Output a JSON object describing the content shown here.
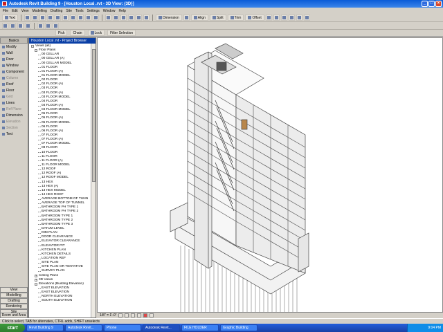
{
  "window": {
    "title": "Autodesk Revit Building 9 - [Houston Local .rvt - 3D View: {3D}]"
  },
  "menu": [
    "File",
    "Edit",
    "View",
    "Modelling",
    "Drafting",
    "Site",
    "Tools",
    "Settings",
    "Window",
    "Help"
  ],
  "toolbar1": {
    "text_tool": "Text",
    "dimension": "Dimension",
    "align": "Align",
    "split": "Split",
    "trim": "Trim",
    "offset": "Offset"
  },
  "toolbar3": {
    "pick": "Pick",
    "chain": "Chain",
    "lock": "Lock",
    "filter": "Filter Selection"
  },
  "design_bar": {
    "header": "Basics",
    "items": [
      {
        "label": "Modify",
        "dim": false
      },
      {
        "label": "Wall",
        "dim": false
      },
      {
        "label": "Door",
        "dim": false
      },
      {
        "label": "Window",
        "dim": false
      },
      {
        "label": "Component",
        "dim": false
      },
      {
        "label": "Column",
        "dim": true
      },
      {
        "label": "Roof",
        "dim": false
      },
      {
        "label": "Floor",
        "dim": false
      },
      {
        "label": "Grid",
        "dim": true
      },
      {
        "label": "Lines",
        "dim": false
      },
      {
        "label": "Ref Plane",
        "dim": true
      },
      {
        "label": "Dimension",
        "dim": false
      },
      {
        "label": "Elevation",
        "dim": true
      },
      {
        "label": "Section",
        "dim": true
      },
      {
        "label": "Text",
        "dim": false
      }
    ],
    "tabs": [
      "View",
      "Modelling",
      "Drafting",
      "Rendering",
      "Site",
      "Room and Area"
    ]
  },
  "browser": {
    "title": "Houston Local .rvt - Project Browser",
    "tree": [
      {
        "indent": 0,
        "box": "-",
        "label": "Views (all)"
      },
      {
        "indent": 1,
        "box": "-",
        "label": "Floor Plans"
      },
      {
        "indent": 2,
        "box": "",
        "label": "00 CELLAR"
      },
      {
        "indent": 2,
        "box": "",
        "label": "00 CELLAR (A)"
      },
      {
        "indent": 2,
        "box": "",
        "label": "00 CELLAR MODEL"
      },
      {
        "indent": 2,
        "box": "",
        "label": "01 FLOOR"
      },
      {
        "indent": 2,
        "box": "",
        "label": "01 FLOOR (A)"
      },
      {
        "indent": 2,
        "box": "",
        "label": "01 FLOOR MODEL"
      },
      {
        "indent": 2,
        "box": "",
        "label": "02 FLOOR"
      },
      {
        "indent": 2,
        "box": "",
        "label": "02 FLOOR (A)"
      },
      {
        "indent": 2,
        "box": "",
        "label": "03 FLOOR"
      },
      {
        "indent": 2,
        "box": "",
        "label": "03 FLOOR (A)"
      },
      {
        "indent": 2,
        "box": "",
        "label": "03 FLOOR MODEL"
      },
      {
        "indent": 2,
        "box": "",
        "label": "04 FLOOR"
      },
      {
        "indent": 2,
        "box": "",
        "label": "04 FLOOR (A)"
      },
      {
        "indent": 2,
        "box": "",
        "label": "04 FLOOR MODEL"
      },
      {
        "indent": 2,
        "box": "",
        "label": "05 FLOOR"
      },
      {
        "indent": 2,
        "box": "",
        "label": "05 FLOOR (A)"
      },
      {
        "indent": 2,
        "box": "",
        "label": "05 FLOOR MODEL"
      },
      {
        "indent": 2,
        "box": "",
        "label": "06 FLOOR"
      },
      {
        "indent": 2,
        "box": "",
        "label": "06 FLOOR (A)"
      },
      {
        "indent": 2,
        "box": "",
        "label": "07 FLOOR"
      },
      {
        "indent": 2,
        "box": "",
        "label": "07 FLOOR (A)"
      },
      {
        "indent": 2,
        "box": "",
        "label": "07 FLOOR MODEL"
      },
      {
        "indent": 2,
        "box": "",
        "label": "08 FLOOR"
      },
      {
        "indent": 2,
        "box": "",
        "label": "10 FLOOR"
      },
      {
        "indent": 2,
        "box": "",
        "label": "11 FLOOR"
      },
      {
        "indent": 2,
        "box": "",
        "label": "11 FLOOR (A)"
      },
      {
        "indent": 2,
        "box": "",
        "label": "11 FLOOR MODEL"
      },
      {
        "indent": 2,
        "box": "",
        "label": "12 ROOF"
      },
      {
        "indent": 2,
        "box": "",
        "label": "12 ROOF (A)"
      },
      {
        "indent": 2,
        "box": "",
        "label": "12 ROOF MODEL"
      },
      {
        "indent": 2,
        "box": "",
        "label": "13 HEX"
      },
      {
        "indent": 2,
        "box": "",
        "label": "13 HEX (A)"
      },
      {
        "indent": 2,
        "box": "",
        "label": "13 HEX MODEL"
      },
      {
        "indent": 2,
        "box": "",
        "label": "14 HEX ROOF"
      },
      {
        "indent": 2,
        "box": "",
        "label": "AVERAGE BOTTOM OF TUNN"
      },
      {
        "indent": 2,
        "box": "",
        "label": "AVERAGE TOP OF TUNNEL"
      },
      {
        "indent": 2,
        "box": "",
        "label": "BATHROOM PH TYPE 1"
      },
      {
        "indent": 2,
        "box": "",
        "label": "BATHROOM PH TYPE 2"
      },
      {
        "indent": 2,
        "box": "",
        "label": "BATHROOM TYPE 1"
      },
      {
        "indent": 2,
        "box": "",
        "label": "BATHROOM TYPE 2"
      },
      {
        "indent": 2,
        "box": "",
        "label": "BATHROOM TYPE 3"
      },
      {
        "indent": 2,
        "box": "",
        "label": "DATUM LEVEL"
      },
      {
        "indent": 2,
        "box": "",
        "label": "DIM PLAN"
      },
      {
        "indent": 2,
        "box": "",
        "label": "DOOR CLEARANCE"
      },
      {
        "indent": 2,
        "box": "",
        "label": "ELEVATOR CLEARANCE"
      },
      {
        "indent": 2,
        "box": "",
        "label": "ELEVATOR PIT"
      },
      {
        "indent": 2,
        "box": "",
        "label": "KITCHEN PLAN"
      },
      {
        "indent": 2,
        "box": "",
        "label": "KITCHEN DETAILS"
      },
      {
        "indent": 2,
        "box": "",
        "label": "LOCATION REF"
      },
      {
        "indent": 2,
        "box": "",
        "label": "SITE PLAN"
      },
      {
        "indent": 2,
        "box": "",
        "label": "SITE PLAN OR TENTATIVE"
      },
      {
        "indent": 2,
        "box": "",
        "label": "SURVEY PLAN"
      },
      {
        "indent": 1,
        "box": "+",
        "label": "Ceiling Plans"
      },
      {
        "indent": 1,
        "box": "+",
        "label": "3D Views"
      },
      {
        "indent": 1,
        "box": "-",
        "label": "Elevations (Building Elevation)"
      },
      {
        "indent": 2,
        "box": "",
        "label": "EAST ELEVATION"
      },
      {
        "indent": 2,
        "box": "",
        "label": "EAST ELEVATION"
      },
      {
        "indent": 2,
        "box": "",
        "label": "NORTH ELEVATION"
      },
      {
        "indent": 2,
        "box": "",
        "label": "SOUTH ELEVATION"
      }
    ]
  },
  "view_control": {
    "scale": "1/8\" = 1'-0\""
  },
  "status": "Click to select, TAB for alternates, CTRL adds, SHIFT unselects",
  "taskbar": {
    "start": "start",
    "tasks": [
      "Revit Building 9",
      "Autodesk Revit...",
      "Phone",
      "Autodesk Revit...",
      "FILE HOLDER",
      "Graphic Building"
    ],
    "active": 3,
    "clock": "9:04 PM"
  }
}
